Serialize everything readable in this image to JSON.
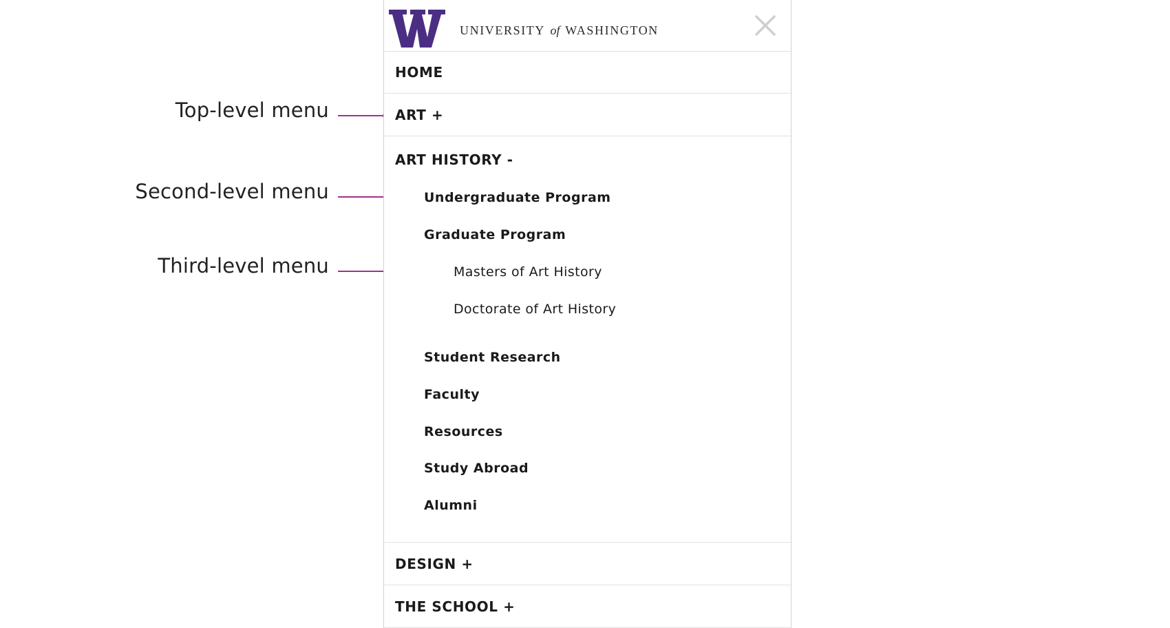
{
  "annotations": {
    "top_level": "Top-level menu",
    "second_level": "Second-level menu",
    "third_level": "Third-level menu",
    "line_color": "#a3308a"
  },
  "header": {
    "brand_letter": "W",
    "brand_color": "#4b2e83",
    "wordmark_pre": "UNIVERSITY",
    "wordmark_of": "of",
    "wordmark_post": "WASHINGTON",
    "close_icon": "close-x-icon"
  },
  "menu": {
    "home": "HOME",
    "art": "ART +",
    "art_history": "ART HISTORY -",
    "second_level": [
      "Undergraduate Program",
      "Graduate Program",
      "Student Research",
      "Faculty",
      "Resources",
      "Study Abroad",
      "Alumni"
    ],
    "third_level": [
      "Masters of Art History",
      "Doctorate of Art History"
    ],
    "design": "DESIGN +",
    "the_school": "THE SCHOOL +"
  }
}
